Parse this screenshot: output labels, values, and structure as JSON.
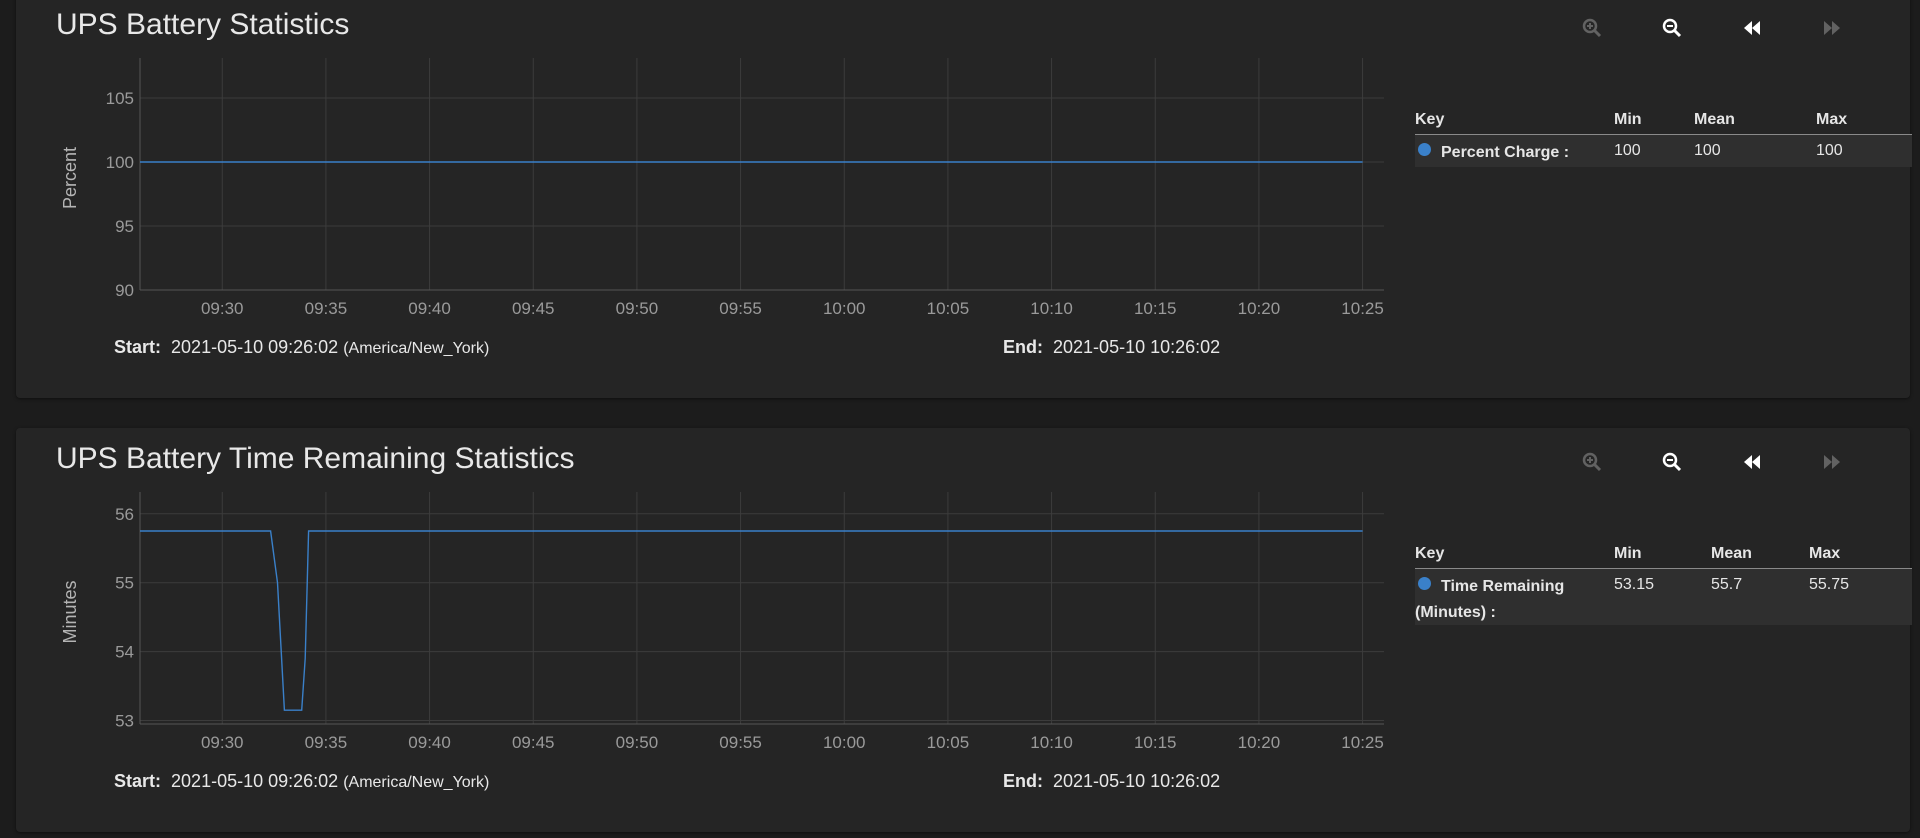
{
  "panels": [
    {
      "title": "UPS Battery Statistics",
      "chart_data": {
        "type": "line",
        "ylabel": "Percent",
        "x_ticks": [
          "09:30",
          "09:35",
          "09:40",
          "09:45",
          "09:50",
          "09:55",
          "10:00",
          "10:05",
          "10:10",
          "10:15",
          "10:20",
          "10:25"
        ],
        "xlim": [
          "09:26:02",
          "10:26:02"
        ],
        "y_ticks": [
          90,
          95,
          100,
          105
        ],
        "ylim": [
          90,
          107.5
        ],
        "series": [
          {
            "name": "Percent Charge",
            "color": "#3a80c9",
            "points": [
              [
                "09:26:02",
                100
              ],
              [
                "10:25:00",
                100
              ]
            ]
          }
        ]
      },
      "range": {
        "start_label": "Start:",
        "start_value": "2021-05-10 09:26:02",
        "timezone": "(America/New_York)",
        "end_label": "End:",
        "end_value": "2021-05-10 10:26:02"
      },
      "legend": {
        "headers": {
          "key": "Key",
          "min": "Min",
          "mean": "Mean",
          "max": "Max"
        },
        "rows": [
          {
            "name": "Percent Charge :",
            "min": "100",
            "mean": "100",
            "max": "100",
            "color": "#3a80c9"
          }
        ]
      },
      "toolbar": {
        "zoom_in": "zoom-in-icon",
        "zoom_out": "zoom-out-icon",
        "back": "step-back-icon",
        "forward": "step-forward-icon"
      }
    },
    {
      "title": "UPS Battery Time Remaining Statistics",
      "chart_data": {
        "type": "line",
        "ylabel": "Minutes",
        "x_ticks": [
          "09:30",
          "09:35",
          "09:40",
          "09:45",
          "09:50",
          "09:55",
          "10:00",
          "10:05",
          "10:10",
          "10:15",
          "10:20",
          "10:25"
        ],
        "xlim": [
          "09:26:02",
          "10:26:02"
        ],
        "y_ticks": [
          53,
          54,
          55,
          56
        ],
        "ylim": [
          52.95,
          56.2
        ],
        "series": [
          {
            "name": "Time Remaining (Minutes)",
            "color": "#3a80c9",
            "points": [
              [
                "09:26:02",
                55.75
              ],
              [
                "09:32:20",
                55.75
              ],
              [
                "09:32:40",
                55.0
              ],
              [
                "09:33:00",
                53.15
              ],
              [
                "09:33:50",
                53.15
              ],
              [
                "09:34:00",
                53.9
              ],
              [
                "09:34:10",
                55.75
              ],
              [
                "10:25:00",
                55.75
              ]
            ]
          }
        ]
      },
      "range": {
        "start_label": "Start:",
        "start_value": "2021-05-10 09:26:02",
        "timezone": "(America/New_York)",
        "end_label": "End:",
        "end_value": "2021-05-10 10:26:02"
      },
      "legend": {
        "headers": {
          "key": "Key",
          "min": "Min",
          "mean": "Mean",
          "max": "Max"
        },
        "rows": [
          {
            "name": "Time Remaining (Minutes) :",
            "min": "53.15",
            "mean": "55.7",
            "max": "55.75",
            "color": "#3a80c9"
          }
        ]
      },
      "toolbar": {
        "zoom_in": "zoom-in-icon",
        "zoom_out": "zoom-out-icon",
        "back": "step-back-icon",
        "forward": "step-forward-icon"
      }
    }
  ]
}
